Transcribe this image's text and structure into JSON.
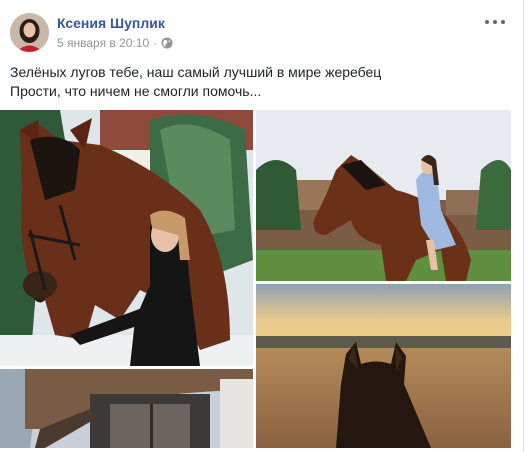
{
  "post": {
    "author_name": "Ксения Шуплик",
    "timestamp": "5 января в 20:10",
    "separator": "·",
    "privacy_icon": "globe-icon",
    "options_icon": "more-options-icon",
    "text_lines": [
      "Зелёных лугов тебе, наш самый лучший в мире жеребец",
      "Прости, что ничем не смогли помочь..."
    ],
    "photos": [
      {
        "subject": "woman-with-bay-horse-photo"
      },
      {
        "subject": "rider-on-horse-photo"
      },
      {
        "subject": "sunset-field-horse-ears-photo"
      },
      {
        "subject": "stable-building-photo"
      }
    ]
  },
  "colors": {
    "link": "#385898",
    "meta": "#90949c",
    "text": "#1d2129",
    "background": "#e9ebee"
  }
}
